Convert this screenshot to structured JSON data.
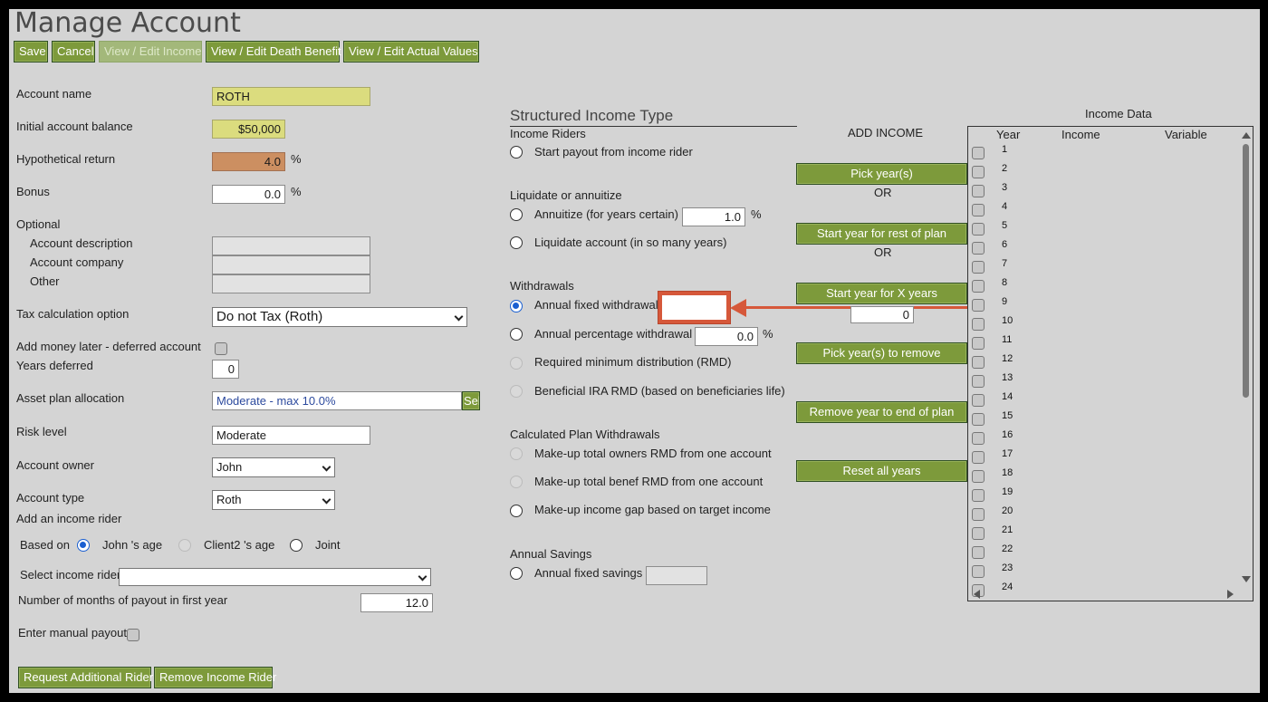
{
  "page_title": "Manage Account",
  "toolbar": {
    "save": "Save",
    "cancel": "Cancel",
    "view_income": "View / Edit Income",
    "view_death_benefit": "View / Edit Death Benefit",
    "view_actual_values": "View / Edit Actual Values"
  },
  "form": {
    "account_name": {
      "label": "Account name",
      "value": "ROTH"
    },
    "initial_balance": {
      "label": "Initial account balance",
      "value": "$50,000"
    },
    "hypothetical_return": {
      "label": "Hypothetical return",
      "value": "4.0",
      "unit": "%"
    },
    "bonus": {
      "label": "Bonus",
      "value": "0.0",
      "unit": "%"
    },
    "optional": {
      "label": "Optional",
      "description": "Account description",
      "company": "Account company",
      "other": "Other"
    },
    "tax_option": {
      "label": "Tax calculation option",
      "value": "Do not Tax (Roth)"
    },
    "add_money_later": {
      "label": "Add money later - deferred account",
      "checked": false
    },
    "years_deferred": {
      "label": "Years deferred",
      "value": "0"
    },
    "asset_plan": {
      "label": "Asset plan allocation",
      "value": "Moderate - max 10.0%",
      "select_button": "Sel"
    },
    "risk_level": {
      "label": "Risk level",
      "value": "Moderate"
    },
    "account_owner": {
      "label": "Account owner",
      "value": "John"
    },
    "account_type": {
      "label": "Account type",
      "value": "Roth"
    },
    "income_rider": {
      "heading": "Add an income rider",
      "based_on": "Based on",
      "options": [
        "John 's age",
        "Client2 's age",
        "Joint"
      ],
      "selected": "John 's age",
      "select_label": "Select income rider",
      "select_value": "",
      "months_label": "Number of months of payout in first year",
      "months_value": "12.0",
      "manual_payout_label": "Enter manual payout"
    },
    "buttons": {
      "request_rider": "Request Additional Rider",
      "remove_rider": "Remove Income Rider"
    }
  },
  "structured": {
    "title": "Structured Income Type",
    "income_riders": {
      "heading": "Income Riders",
      "start_payout": "Start payout from income rider"
    },
    "liquidate": {
      "heading": "Liquidate or annuitize",
      "annuitize": "Annuitize (for years certain)",
      "annuitize_value": "1.0",
      "annuitize_unit": "%",
      "liquidate": "Liquidate account (in so many years)"
    },
    "withdrawals": {
      "heading": "Withdrawals",
      "annual_fixed": "Annual fixed withdrawal",
      "annual_fixed_value": "",
      "annual_percentage": "Annual percentage withdrawal",
      "annual_percentage_value": "0.0",
      "annual_percentage_unit": "%",
      "rmd": "Required minimum distribution (RMD)",
      "beneficial_rmd": "Beneficial IRA RMD (based on beneficiaries life)",
      "selected": "Annual fixed withdrawal"
    },
    "calculated": {
      "heading": "Calculated Plan Withdrawals",
      "owners_rmd": "Make-up total owners RMD from one account",
      "benef_rmd": "Make-up total benef RMD from one account",
      "income_gap": "Make-up income gap based on target income"
    },
    "savings": {
      "heading": "Annual Savings",
      "fixed": "Annual fixed savings",
      "fixed_value": ""
    }
  },
  "add_income": {
    "heading": "ADD INCOME",
    "pick_years": "Pick year(s)",
    "or1": "OR",
    "start_rest": "Start year for rest of plan",
    "or2": "OR",
    "start_x": "Start year for X years",
    "x_years_value": "0",
    "pick_remove": "Pick year(s) to remove",
    "remove_end": "Remove year to end of plan",
    "reset_all": "Reset all years"
  },
  "income_data": {
    "title": "Income Data",
    "columns": [
      "Year",
      "Income",
      "Variable"
    ],
    "years": [
      "1",
      "2",
      "3",
      "4",
      "5",
      "6",
      "7",
      "8",
      "9",
      "10",
      "11",
      "12",
      "13",
      "14",
      "15",
      "16",
      "17",
      "18",
      "19",
      "20",
      "21",
      "22",
      "23",
      "24"
    ]
  },
  "colors": {
    "button": "#7d9a3b",
    "highlight": "#d6583a",
    "accent": "#1a5fd1"
  }
}
